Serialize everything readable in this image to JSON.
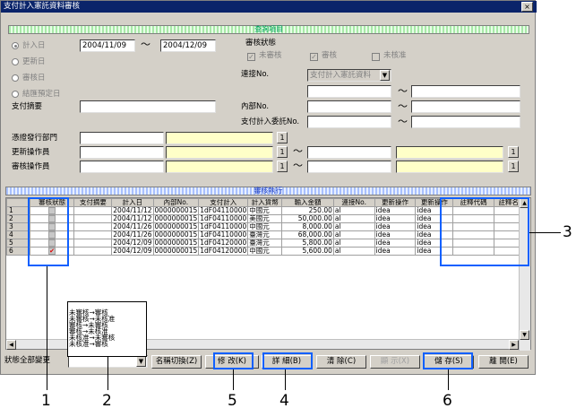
{
  "window": {
    "title": "支付計入憲託資料審核",
    "close_label": "×"
  },
  "search_section": {
    "title": "查詢項目"
  },
  "date_radios": [
    {
      "label": "計入日",
      "selected": true
    },
    {
      "label": "更新日",
      "selected": false
    },
    {
      "label": "審核日",
      "selected": false
    },
    {
      "label": "結匯預定日",
      "selected": false
    }
  ],
  "date_from": "2004/11/09",
  "date_sep": "～",
  "date_to": "2004/12/09",
  "review_status": {
    "label": "審核狀態",
    "options": [
      {
        "label": "未審核",
        "checked": true
      },
      {
        "label": "審核",
        "checked": true
      },
      {
        "label": "未核准",
        "checked": false
      }
    ]
  },
  "link_no": {
    "label": "連接No.",
    "value": "支付計入憲託資料",
    "arrow": "▼"
  },
  "payment_summary": {
    "label": "支付摘要",
    "value": ""
  },
  "internal_no": {
    "label": "內部No."
  },
  "payment_trust_no": {
    "label": "支付計入委託No."
  },
  "range_sep": "～",
  "issuing_dept": {
    "label": "憑證發行部門",
    "btn": "1"
  },
  "update_operator": {
    "label": "更新操作員",
    "btn": "1",
    "btn2": "1"
  },
  "review_operator": {
    "label": "審核操作員",
    "btn": "1",
    "btn2": "1"
  },
  "grid": {
    "section_title": "審核執行",
    "columns": [
      "",
      "審核狀態",
      "支付摘要",
      "計入日",
      "內部No.",
      "支付計入",
      "計入貨幣",
      "輸入金額",
      "連接No.",
      "更新操作",
      "更新操作",
      "註釋代碼",
      "註釋名稱"
    ],
    "rows": [
      {
        "n": "1",
        "status": "",
        "date": "2004/11/12",
        "internal": "0000000015",
        "pay": "1dF04110000",
        "currency": "中國元",
        "amount": "250.00",
        "link": "al",
        "op1": "idea",
        "op2": "idea"
      },
      {
        "n": "2",
        "status": "",
        "date": "2004/11/12",
        "internal": "0000000015",
        "pay": "1dF04110000",
        "currency": "美國元",
        "amount": "50,000.00",
        "link": "al",
        "op1": "idea",
        "op2": "idea"
      },
      {
        "n": "3",
        "status": "",
        "date": "2004/11/26",
        "internal": "0000000015",
        "pay": "1dF04110000",
        "currency": "中國元",
        "amount": "8,000.00",
        "link": "al",
        "op1": "idea",
        "op2": "idea"
      },
      {
        "n": "4",
        "status": "",
        "date": "2004/11/26",
        "internal": "0000000015",
        "pay": "1dF04110000",
        "currency": "臺灣元",
        "amount": "68,000.00",
        "link": "al",
        "op1": "idea",
        "op2": "idea"
      },
      {
        "n": "5",
        "status": "",
        "date": "2004/12/09",
        "internal": "0000000015",
        "pay": "1dF04120000",
        "currency": "臺灣元",
        "amount": "5,800.00",
        "link": "al",
        "op1": "idea",
        "op2": "idea"
      },
      {
        "n": "6",
        "status": "✔",
        "date": "2004/12/09",
        "internal": "0000000015",
        "pay": "1dF04120000",
        "currency": "中國元",
        "amount": "5,600.00",
        "link": "al",
        "op1": "idea",
        "op2": "idea"
      }
    ]
  },
  "status_popup": {
    "options": [
      "未審核→審核",
      "未審核→未核准",
      "審核→未審核",
      "審核→未核准",
      "未核准→未審核",
      "未核准→審核"
    ]
  },
  "bottom": {
    "status_change_label": "狀態全部變更",
    "dropdown_arrow": "▼",
    "buttons": {
      "switch": "名稱切換(Z)",
      "modify": "修 改(K)",
      "detail": "詳 細(B)",
      "clear": "清 除(C)",
      "display": "顯 示(X)",
      "save": "儲 存(S)",
      "close": "離 開(E)"
    }
  },
  "callouts": [
    "1",
    "2",
    "3",
    "4",
    "5",
    "6"
  ],
  "colors": {
    "titlebar": "#0a246a",
    "highlight": "#1060ff",
    "window": "#d4d0c8"
  }
}
